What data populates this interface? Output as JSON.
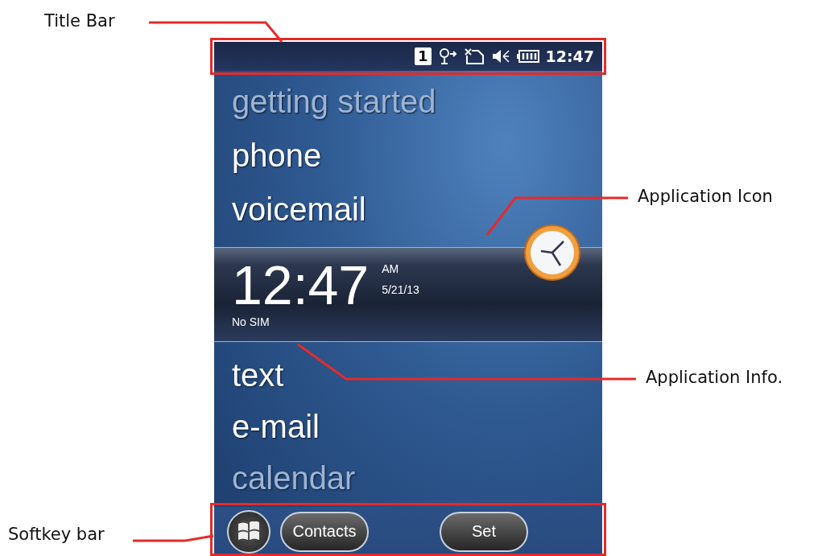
{
  "annotations": [
    {
      "label": "Title Bar",
      "kind": "title"
    },
    {
      "label": "Application Icon",
      "kind": "icon"
    },
    {
      "label": "Application Info.",
      "kind": "info"
    },
    {
      "label": "Softkey bar",
      "kind": "softkey"
    }
  ],
  "status_bar": {
    "badge": "1",
    "time": "12:47"
  },
  "menu_top": [
    {
      "label": "getting started",
      "faded": true
    },
    {
      "label": "phone",
      "faded": false
    },
    {
      "label": "voicemail",
      "faded": false
    }
  ],
  "clock_panel": {
    "time": "12:47",
    "meridiem": "AM",
    "date": "5/21/13",
    "status": "No SIM"
  },
  "menu_bottom": [
    {
      "label": "text",
      "faded": false
    },
    {
      "label": "e-mail",
      "faded": false
    },
    {
      "label": "calendar",
      "faded": true
    }
  ],
  "softkeys": [
    {
      "label": "Contacts"
    },
    {
      "label": "Set"
    }
  ]
}
